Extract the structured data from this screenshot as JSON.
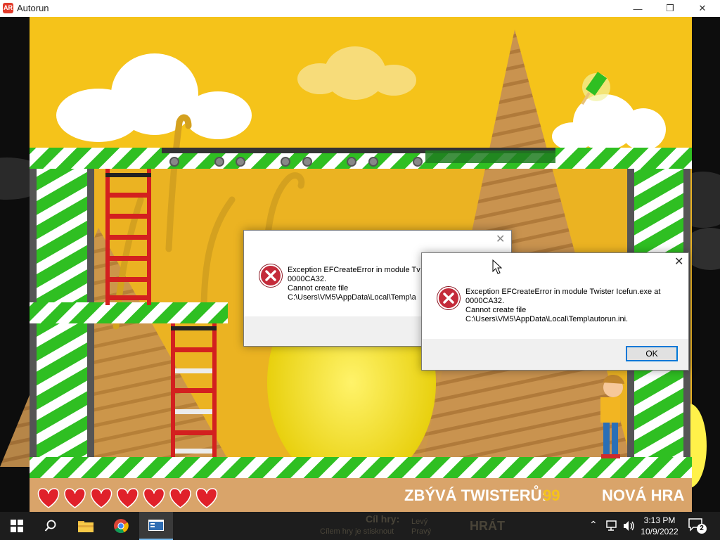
{
  "window": {
    "title": "Autorun",
    "app_icon_glyph": "AR",
    "controls": {
      "minimize": "—",
      "maximize": "❐",
      "close": "✕"
    }
  },
  "game": {
    "hud": {
      "lives": 7,
      "twisters_label": "ZBÝVÁ TWISTERŮ:",
      "twisters_count": "99",
      "new_game": "NOVÁ HRA"
    },
    "colors": {
      "sky": "#f5c31a",
      "stripe_green": "#2fbf22",
      "stripe_white": "#ffffff",
      "ladder_red": "#d3201f"
    }
  },
  "dialogs": [
    {
      "lines": [
        "Exception EFCreateError in module Tv",
        "0000CA32.",
        "Cannot create file",
        "C:\\Users\\VM5\\AppData\\Local\\Temp\\a"
      ]
    },
    {
      "lines": [
        "Exception EFCreateError in module Twister Icefun.exe at",
        "0000CA32.",
        "Cannot create file",
        "C:\\Users\\VM5\\AppData\\Local\\Temp\\autorun.ini."
      ],
      "ok_label": "OK"
    }
  ],
  "taskbar": {
    "time": "3:13 PM",
    "date": "10/9/2022",
    "notification_count": "2",
    "apps": [
      "start-icon",
      "search-icon",
      "file-explorer-icon",
      "chrome-icon",
      "autorun-icon"
    ],
    "ghost_text": [
      "Cíl hry:",
      "Cílem hry je stisknout",
      "Levý",
      "Pravý",
      "HRÁT"
    ]
  }
}
